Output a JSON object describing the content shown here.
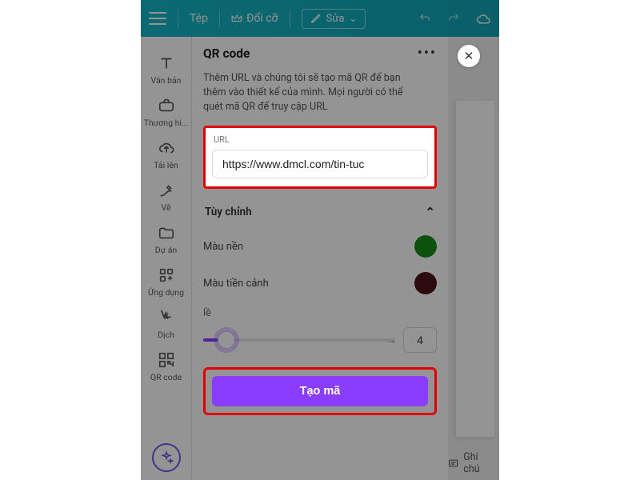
{
  "topbar": {
    "file_label": "Tệp",
    "resize_label": "Đổi cỡ",
    "edit_label": "Sửa"
  },
  "rail": {
    "text": "Văn bản",
    "brands": "Thương hi...",
    "upload": "Tải lên",
    "draw": "Vẽ",
    "project": "Dự án",
    "apps": "Ứng dụng",
    "translate": "Dịch",
    "qrcode": "QR code"
  },
  "panel": {
    "title": "QR code",
    "description": "Thêm URL và chúng tôi sẽ tạo mã QR để bạn thêm vào thiết kế của mình. Mọi người có thể quét mã QR để truy cập URL",
    "url_label": "URL",
    "url_value": "https://www.dmcl.com/tin-tuc",
    "customize_label": "Tùy chỉnh",
    "background_label": "Màu nền",
    "foreground_label": "Màu tiền cảnh",
    "margin_label": "lề",
    "margin_value": "4",
    "cta_label": "Tạo mã"
  },
  "canvas": {
    "notes_label": "Ghi chú"
  },
  "colors": {
    "background_swatch": "#158c15",
    "foreground_swatch": "#4a1414",
    "accent": "#8b3dff",
    "highlight_border": "#e00000"
  }
}
